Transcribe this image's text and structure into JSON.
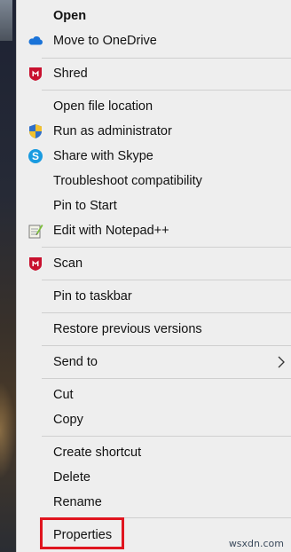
{
  "context_menu": {
    "items": [
      {
        "label": "Open",
        "icon": "",
        "bold": true
      },
      {
        "label": "Move to OneDrive",
        "icon": "onedrive-cloud-icon"
      },
      {
        "label": "Shred",
        "icon": "mcafee-shield-icon"
      },
      {
        "label": "Open file location",
        "icon": ""
      },
      {
        "label": "Run as administrator",
        "icon": "uac-shield-icon"
      },
      {
        "label": "Share with Skype",
        "icon": "skype-icon"
      },
      {
        "label": "Troubleshoot compatibility",
        "icon": ""
      },
      {
        "label": "Pin to Start",
        "icon": ""
      },
      {
        "label": "Edit with Notepad++",
        "icon": "notepad-plus-plus-icon"
      },
      {
        "label": "Scan",
        "icon": "mcafee-shield-icon"
      },
      {
        "label": "Pin to taskbar",
        "icon": ""
      },
      {
        "label": "Restore previous versions",
        "icon": ""
      },
      {
        "label": "Send to",
        "icon": "",
        "submenu": true
      },
      {
        "label": "Cut",
        "icon": ""
      },
      {
        "label": "Copy",
        "icon": ""
      },
      {
        "label": "Create shortcut",
        "icon": ""
      },
      {
        "label": "Delete",
        "icon": ""
      },
      {
        "label": "Rename",
        "icon": ""
      },
      {
        "label": "Properties",
        "icon": "",
        "highlighted": true
      }
    ]
  },
  "highlight_color": "#e0151f",
  "accent_colors": {
    "onedrive": "#1a73d8",
    "mcafee": "#c8102e",
    "skype": "#1a9be0"
  },
  "watermark": "wsxdn.com"
}
